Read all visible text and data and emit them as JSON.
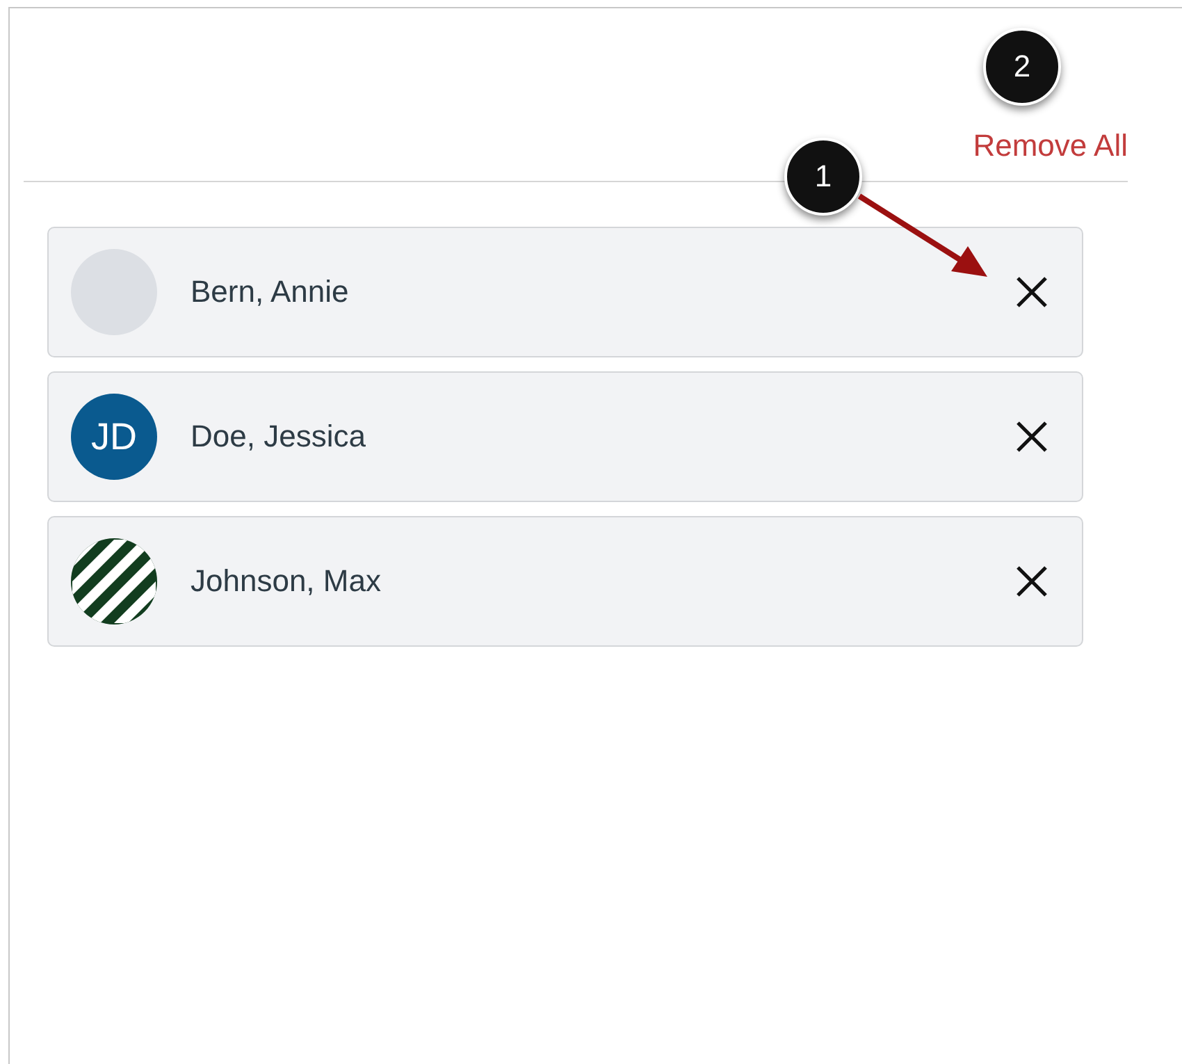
{
  "header": {
    "remove_all": "Remove All"
  },
  "recipients": [
    {
      "name": "Bern, Annie",
      "avatar": {
        "kind": "photo"
      }
    },
    {
      "name": "Doe, Jessica",
      "avatar": {
        "kind": "initials",
        "text": "JD"
      }
    },
    {
      "name": "Johnson, Max",
      "avatar": {
        "kind": "pattern"
      }
    }
  ],
  "callouts": [
    {
      "label": "1",
      "kind": "arrow"
    },
    {
      "label": "2",
      "kind": "plain"
    }
  ]
}
